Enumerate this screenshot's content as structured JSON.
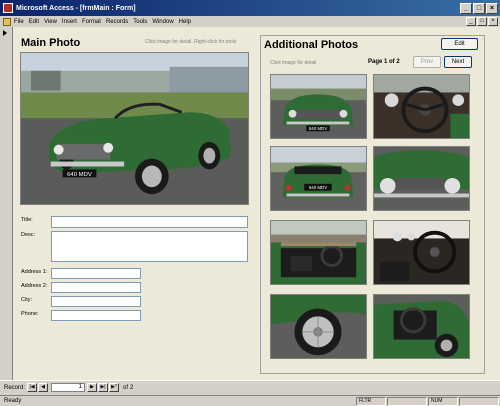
{
  "window": {
    "title": "Microsoft Access - [frmMain : Form]",
    "min": "_",
    "max": "□",
    "close": "×"
  },
  "menu": [
    "File",
    "Edit",
    "View",
    "Insert",
    "Format",
    "Records",
    "Tools",
    "Window",
    "Help"
  ],
  "main": {
    "title": "Main Photo",
    "hint": "Click image for detail. Right-click for tools",
    "plate": "640 MDV"
  },
  "fields": {
    "title": "Title:",
    "desc": "Desc:",
    "address1": "Address 1:",
    "address2": "Address 2:",
    "city": "City:",
    "phone": "Phone:"
  },
  "additional": {
    "title": "Additional Photos",
    "edit": "Edit",
    "hint": "Click image for detail",
    "page": "Page 1 of 2",
    "prev": "Prev",
    "next": "Next",
    "plate": "640 MDV"
  },
  "nav": {
    "label": "Record:",
    "current": "1",
    "of": "of",
    "total": "2",
    "first": "|◀",
    "prev": "◀",
    "next": "▶",
    "last": "▶|",
    "new": "▶*"
  },
  "status": {
    "text": "Ready",
    "indicators": [
      "FLTR",
      "NUM"
    ]
  },
  "colors": {
    "car_green": "#2f6b35",
    "titlebar": "#0a246a"
  }
}
